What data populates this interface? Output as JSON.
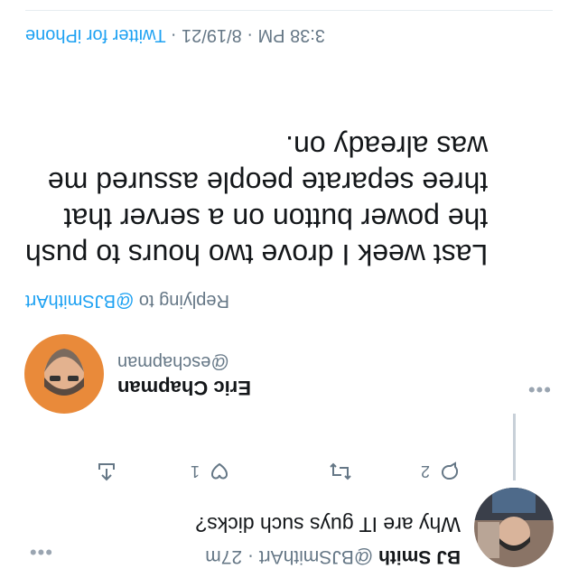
{
  "reply_tweet": {
    "author_name": "BJ Smith",
    "handle": "@BJSmithArt",
    "time_ago": "27m",
    "text": "Why are IT guys such dicks?",
    "more_icon": "more-dots-icon",
    "actions": {
      "reply_count": "2",
      "like_count": "1"
    }
  },
  "main_tweet": {
    "author_name": "Eric Chapman",
    "handle": "@eschapman",
    "replying_to_prefix": "Replying to",
    "replying_to_handle": "@BJSmithArt",
    "body_lines": [
      "Last week I drove two hours to push",
      "the power button on a server that",
      "three separate people assured me",
      "was already on."
    ],
    "timestamp": "3:38 PM · 8/19/21 · ",
    "source": "Twitter for iPhone",
    "more_icon": "more-dots-icon"
  },
  "colors": {
    "link": "#1da1f2",
    "secondary_text": "#657786",
    "primary_text": "#14171a"
  }
}
